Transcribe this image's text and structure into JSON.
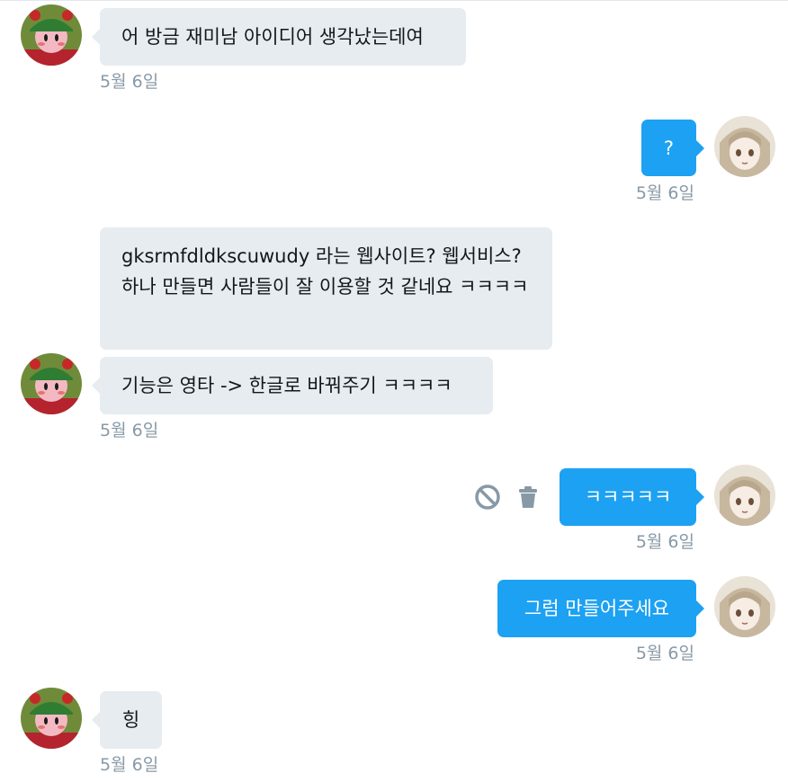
{
  "conversation": {
    "messages": [
      {
        "sender": "other",
        "text": "어 방금 재미남 아이디어 생각났는데여",
        "time": "5월 6일"
      },
      {
        "sender": "me",
        "text": "?",
        "time": "5월 6일"
      },
      {
        "sender": "other",
        "text": "gksrmfdldkscuwudy 라는 웹사이트? 웹서비스? 하나 만들면 사람들이 잘 이용할 것 같네요 ㅋㅋㅋㅋ"
      },
      {
        "sender": "other",
        "text": "기능은 영타 -> 한글로 바꿔주기 ㅋㅋㅋㅋ",
        "time": "5월 6일"
      },
      {
        "sender": "me",
        "text": "ㅋㅋㅋㅋㅋ",
        "time": "5월 6일"
      },
      {
        "sender": "me",
        "text": "그럼 만들어주세요",
        "time": "5월 6일"
      },
      {
        "sender": "other",
        "text": "힝",
        "time": "5월 6일"
      }
    ]
  },
  "icons": {
    "block": "block-icon",
    "delete": "trash-icon"
  },
  "colors": {
    "incoming_bubble": "#e6ecf0",
    "outgoing_bubble": "#1da1f2",
    "timestamp": "#8899a6"
  }
}
